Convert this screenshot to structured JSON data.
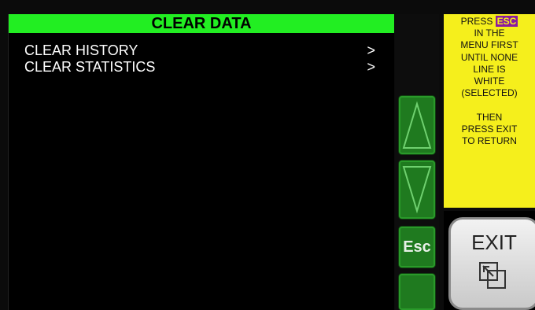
{
  "title": "CLEAR DATA",
  "menu": {
    "items": [
      {
        "label": "CLEAR HISTORY",
        "arrow": ">"
      },
      {
        "label": "CLEAR STATISTICS",
        "arrow": ">"
      }
    ]
  },
  "side_buttons": {
    "up": "up-arrow-icon",
    "down": "down-arrow-icon",
    "esc_label": "Esc"
  },
  "note": {
    "press": "PRESS",
    "esc": "ESC",
    "lines1": [
      "IN THE",
      "MENU FIRST",
      "UNTIL NONE",
      "LINE IS",
      "WHITE",
      "(SELECTED)"
    ],
    "lines2": [
      "THEN",
      "PRESS EXIT",
      "TO RETURN"
    ]
  },
  "exit": {
    "label": "EXIT",
    "icon": "window-return-icon"
  },
  "colors": {
    "title_bar": "#22ee22",
    "note_bg": "#f5ef1c",
    "esc_highlight": "#8a1aa0",
    "button_green": "#1f7a1f"
  }
}
